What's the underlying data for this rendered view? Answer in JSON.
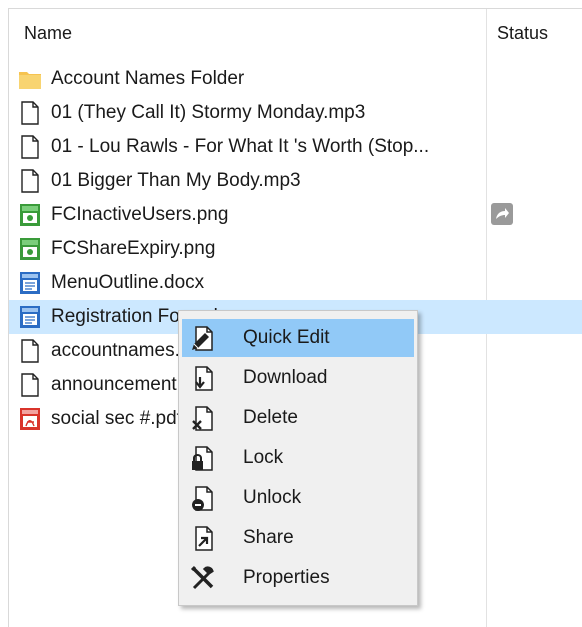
{
  "columns": {
    "name": "Name",
    "status": "Status"
  },
  "files": [
    {
      "name": "Account Names Folder",
      "icon": "folder-icon",
      "selected": false
    },
    {
      "name": "01 (They Call It) Stormy Monday.mp3",
      "icon": "document-icon",
      "selected": false
    },
    {
      "name": "01 - Lou Rawls - For What It 's Worth (Stop...",
      "icon": "document-icon",
      "selected": false
    },
    {
      "name": "01 Bigger Than My Body.mp3",
      "icon": "document-icon",
      "selected": false
    },
    {
      "name": "FCInactiveUsers.png",
      "icon": "image-file-icon",
      "selected": false,
      "status_icon": "share-arrow-icon"
    },
    {
      "name": "FCShareExpiry.png",
      "icon": "image-file-icon",
      "selected": false
    },
    {
      "name": "MenuOutline.docx",
      "icon": "word-doc-icon",
      "selected": false
    },
    {
      "name": "Registration Form.docx",
      "icon": "word-doc-icon",
      "selected": true
    },
    {
      "name": "accountnames.txt",
      "icon": "document-icon",
      "selected": false
    },
    {
      "name": "announcement.txt",
      "icon": "document-icon",
      "selected": false
    },
    {
      "name": "social sec #.pdf",
      "icon": "pdf-icon",
      "selected": false
    }
  ],
  "context_menu": {
    "items": [
      {
        "label": "Quick Edit",
        "icon": "quick-edit-icon",
        "highlighted": true
      },
      {
        "label": "Download",
        "icon": "download-icon",
        "highlighted": false
      },
      {
        "label": "Delete",
        "icon": "delete-icon",
        "highlighted": false
      },
      {
        "label": "Lock",
        "icon": "lock-icon",
        "highlighted": false
      },
      {
        "label": "Unlock",
        "icon": "unlock-icon",
        "highlighted": false
      },
      {
        "label": "Share",
        "icon": "share-icon",
        "highlighted": false
      },
      {
        "label": "Properties",
        "icon": "properties-icon",
        "highlighted": false
      }
    ]
  },
  "colors": {
    "selected_row": "#cce8ff",
    "menu_highlight": "#91c9f7",
    "folder": "#f6c350",
    "image_file": "#3a9b3a",
    "word_doc": "#2b6cc4",
    "pdf": "#d9342b"
  }
}
